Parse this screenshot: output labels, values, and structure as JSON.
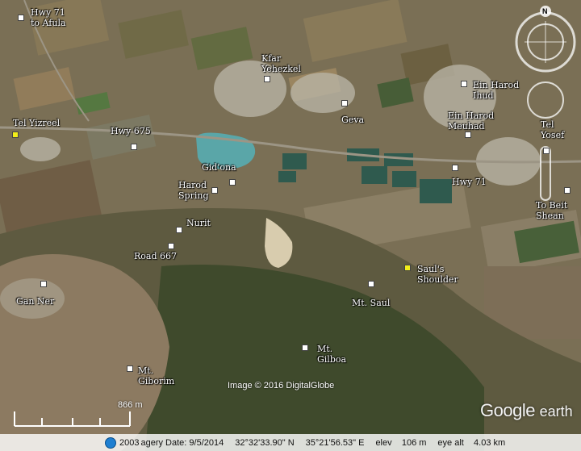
{
  "places": {
    "hwy71_afula": "Hwy 71\nto Afula",
    "kfar_yehezkel": "Kfar\nYehezkel",
    "ein_harod_ihud": "Ein Harod\nIhud",
    "tel_yizreel": "Tel Yizreel",
    "hwy675": "Hwy 675",
    "geva": "Geva",
    "ein_harod_meuhad": "Ein Harod\nMeuhad",
    "tel_yosef": "Tel\nYosef",
    "gidona": "Gid'ona",
    "harod_spring": "Harod\nSpring",
    "hwy71": "Hwy 71",
    "to_beit_shean": "To Beit\nShean",
    "nurit": "Nurit",
    "road667": "Road 667",
    "sauls_shoulder": "Saul's\nShoulder",
    "gan_ner": "Gan Ner",
    "mt_saul": "Mt. Saul",
    "mt_gilboa": "Mt.\nGilboa",
    "mt_giborim": "Mt.\nGiborim"
  },
  "map_info": {
    "copyright": "Image © 2016 DigitalGlobe",
    "logo_google": "Google",
    "logo_earth": "earth",
    "scale_label": "866 m",
    "compass_letter": "N"
  },
  "status": {
    "year_text": "2003",
    "imagery_date": "agery Date: 9/5/2014",
    "lat": "32°32'33.90\" N",
    "lon": "35°21'56.53\" E",
    "elev": "elev    106 m",
    "eye_alt": "eye alt    4.03 km"
  },
  "colors": {
    "placemark_white": "#ffffff",
    "placemark_yellow": "#f2ee1a",
    "reservoir": "#5aa6a8"
  }
}
